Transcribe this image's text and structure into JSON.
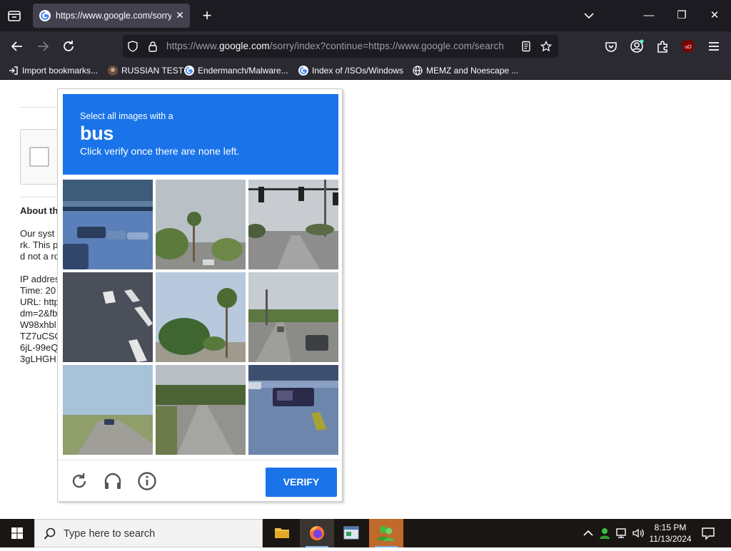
{
  "browser": {
    "tab": {
      "title": "https://www.google.com/sorry/index?continue=https://www.google.com/search",
      "close_glyph": "✕"
    },
    "new_tab_glyph": "+",
    "window_controls": {
      "minimize": "—",
      "restore": "❐",
      "close": "✕"
    },
    "url": {
      "prefix": "https://www.",
      "host": "google.com",
      "rest": "/sorry/index?continue=https://www.google.com/search"
    },
    "bookmarks": [
      {
        "label": "Import bookmarks...",
        "icon": "import-icon"
      },
      {
        "label": "RUSSIAN TEST",
        "icon": "avatar-icon"
      },
      {
        "label": "Endermanch/Malware...",
        "icon": "google-icon"
      },
      {
        "label": "Index of /ISOs/Windows",
        "icon": "google-icon"
      },
      {
        "label": "MEMZ and Noescape ...",
        "icon": "globe-icon"
      }
    ]
  },
  "page": {
    "about_title": "About th",
    "info_lines": [
      "Our syst",
      "rk. This p",
      "d not a ro",
      "",
      "IP addres",
      "Time: 20",
      "URL: http",
      "dm=2&fb",
      "W98xhbl",
      "TZ7uCSC",
      "6jL-99eQ",
      "3gLHGH"
    ]
  },
  "captcha": {
    "instruction_line1": "Select all images with a",
    "target_word": "bus",
    "instruction_line3": "Click verify once there are none left.",
    "verify_label": "VERIFY",
    "accent_color": "#1a73e8"
  },
  "taskbar": {
    "search_placeholder": "Type here to search",
    "time": "8:15 PM",
    "date": "11/13/2024"
  }
}
